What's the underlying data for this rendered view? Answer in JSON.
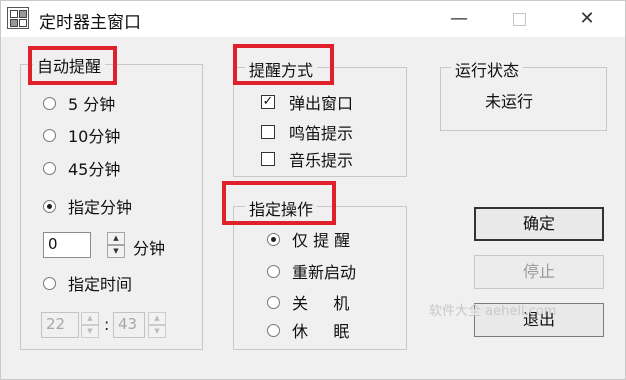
{
  "window": {
    "title": "定时器主窗口",
    "minimize_glyph": "—",
    "close_glyph": "✕"
  },
  "auto_reminder": {
    "legend": "自动提醒",
    "options": [
      {
        "label": "5 分钟",
        "selected": false
      },
      {
        "label": "10分钟",
        "selected": false
      },
      {
        "label": "45分钟",
        "selected": false
      },
      {
        "label": "指定分钟",
        "selected": true
      },
      {
        "label": "指定时间",
        "selected": false
      }
    ],
    "minutes_value": "0",
    "minutes_unit": "分钟",
    "time_hour": "22",
    "time_separator": ":",
    "time_minute": "43"
  },
  "reminder_method": {
    "legend": "提醒方式",
    "options": [
      {
        "label": "弹出窗口",
        "checked": true
      },
      {
        "label": "鸣笛提示",
        "checked": false
      },
      {
        "label": "音乐提示",
        "checked": false
      }
    ]
  },
  "specified_action": {
    "legend": "指定操作",
    "options": [
      {
        "label": "仅 提 醒",
        "selected": true
      },
      {
        "label": "重新启动",
        "selected": false
      },
      {
        "label": "关     机",
        "selected": false
      },
      {
        "label": "休     眠",
        "selected": false
      }
    ]
  },
  "run_status": {
    "legend": "运行状态",
    "value": "未运行"
  },
  "buttons": {
    "confirm": "确定",
    "stop": "停止",
    "exit": "退出"
  },
  "watermark": "软件大全 aehell.com",
  "colors": {
    "highlight": "#e0202a",
    "window_bg": "#f0f0f0"
  }
}
